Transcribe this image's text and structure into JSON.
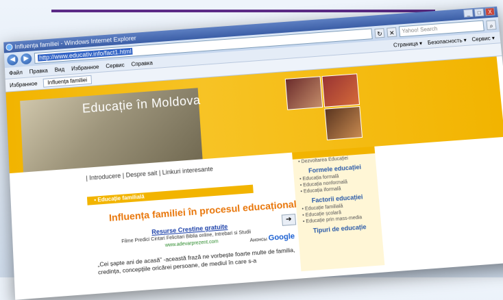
{
  "window": {
    "title": "Influența familiei - Windows Internet Explorer",
    "url": "http://www.educativ.info/fact1.html",
    "search_placeholder": "Yahoo! Search",
    "close_glyph": "X",
    "min_glyph": "_",
    "max_glyph": "□"
  },
  "menu": {
    "items": [
      "Файл",
      "Правка",
      "Вид",
      "Избранное",
      "Сервис",
      "Справка"
    ],
    "right_items": [
      "Страница ▾",
      "Безопасность ▾",
      "Сервис ▾"
    ]
  },
  "favorites": {
    "label": "Избранное",
    "tab": "Influența familiei"
  },
  "page": {
    "banner_title": "Educație în Moldova",
    "links": "| Introducere | Despre sait | Linkuri interesante",
    "section_tab": "• Educație familială",
    "heading": "Influența familiei în procesul educațional",
    "ad": {
      "link": "Resurse Crestine gratuite",
      "desc": "Filme Predici Cintari Felicitari Biblia online, Intrebari si Studii",
      "url": "www.adevarprezent.com",
      "google_label": "Анонсы",
      "google": "Google"
    },
    "paragraph": "„Cei șapte ani de acasă” -această frază ne vorbește foarte multe de familia, credința, concepțiile oricărei persoane, de mediul în care s-a"
  },
  "sidebar": {
    "top_item": "• Dezvoltarea Educației",
    "groups": [
      {
        "heading": "Formele educației",
        "items": [
          "• Educația formală",
          "• Educația nonformală",
          "• Educația iformală"
        ]
      },
      {
        "heading": "Factorii educației",
        "items": [
          "• Educație familială",
          "• Educație școlară",
          "• Educație prin mass-media"
        ]
      },
      {
        "heading": "Tipuri de educație",
        "items": []
      }
    ]
  }
}
